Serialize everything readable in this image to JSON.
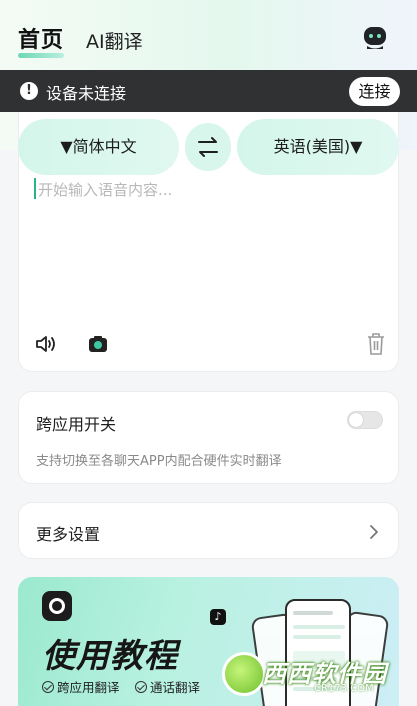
{
  "header": {
    "tab_home": "首页",
    "tab_ai": "AI翻译"
  },
  "status": {
    "message": "设备未连接",
    "connect_label": "连接"
  },
  "translator": {
    "source_lang": "▼简体中文",
    "target_lang": "英语(美国)▼",
    "placeholder": "开始输入语音内容..."
  },
  "cross_app": {
    "title": "跨应用开关",
    "description": "支持切换至各聊天APP内配合硬件实时翻译",
    "enabled": false
  },
  "more_settings": {
    "label": "更多设置"
  },
  "banner": {
    "title": "使用教程",
    "tag1": "跨应用翻译",
    "tag2": "通话翻译"
  },
  "watermark": {
    "text": "西西软件园",
    "sub": "CR173.COM"
  },
  "colors": {
    "accent": "#6cd7b2",
    "status_bar": "#2f3133",
    "pill": "#d4f6ea"
  }
}
